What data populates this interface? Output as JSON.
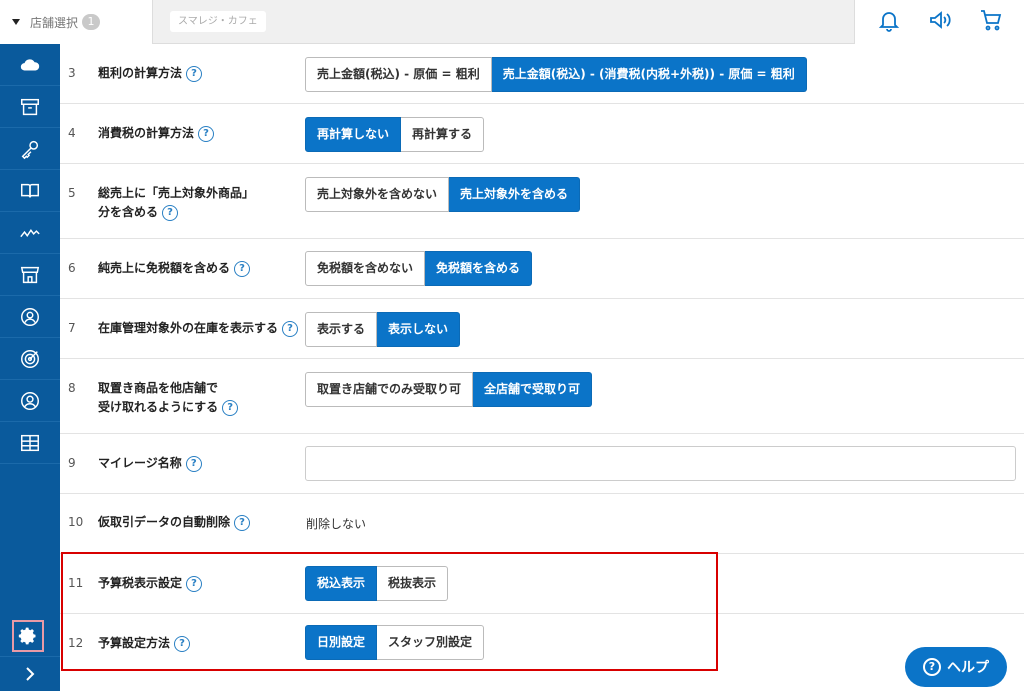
{
  "topbar": {
    "store_select_label": "店舗選択",
    "store_select_count": "1",
    "store_name": "スマレジ・カフェ",
    "icons": [
      "bell-icon",
      "megaphone-icon",
      "cart-icon"
    ]
  },
  "sidebar": {
    "items": [
      "cloud-icon",
      "archive-icon",
      "key-icon",
      "book-icon",
      "chart-line-icon",
      "store-icon",
      "user-circle-icon",
      "target-icon",
      "user-icon",
      "grid-icon"
    ],
    "settings_icon": "gear-icon",
    "expand_icon": "chevron-right-icon"
  },
  "rows": [
    {
      "num": "3",
      "label": "粗利の計算方法",
      "options": [
        "売上金額(税込) - 原価 = 粗利",
        "売上金額(税込) - (消費税(内税+外税)) - 原価 = 粗利"
      ],
      "selected": 1
    },
    {
      "num": "4",
      "label": "消費税の計算方法",
      "options": [
        "再計算しない",
        "再計算する"
      ],
      "selected": 0
    },
    {
      "num": "5",
      "label_line1": "総売上に「売上対象外商品」",
      "label_line2": "分を含める",
      "options": [
        "売上対象外を含めない",
        "売上対象外を含める"
      ],
      "selected": 1
    },
    {
      "num": "6",
      "label": "純売上に免税額を含める",
      "options": [
        "免税額を含めない",
        "免税額を含める"
      ],
      "selected": 1
    },
    {
      "num": "7",
      "label": "在庫管理対象外の在庫を表示する",
      "options": [
        "表示する",
        "表示しない"
      ],
      "selected": 1
    },
    {
      "num": "8",
      "label_line1": "取置き商品を他店舗で",
      "label_line2": "受け取れるようにする",
      "options": [
        "取置き店舗でのみ受取り可",
        "全店舗で受取り可"
      ],
      "selected": 1
    },
    {
      "num": "9",
      "label": "マイレージ名称",
      "value": ""
    },
    {
      "num": "10",
      "label": "仮取引データの自動削除",
      "value": "削除しない"
    },
    {
      "num": "11",
      "label": "予算税表示設定",
      "options": [
        "税込表示",
        "税抜表示"
      ],
      "selected": 0
    },
    {
      "num": "12",
      "label": "予算設定方法",
      "options": [
        "日別設定",
        "スタッフ別設定"
      ],
      "selected": 0
    }
  ],
  "help_glyph": "?",
  "help_button": {
    "label": "ヘルプ",
    "icon_glyph": "?"
  },
  "colors": {
    "sidebar": "#0a5a9c",
    "active": "#0b74c8",
    "highlight": "#d80000"
  }
}
